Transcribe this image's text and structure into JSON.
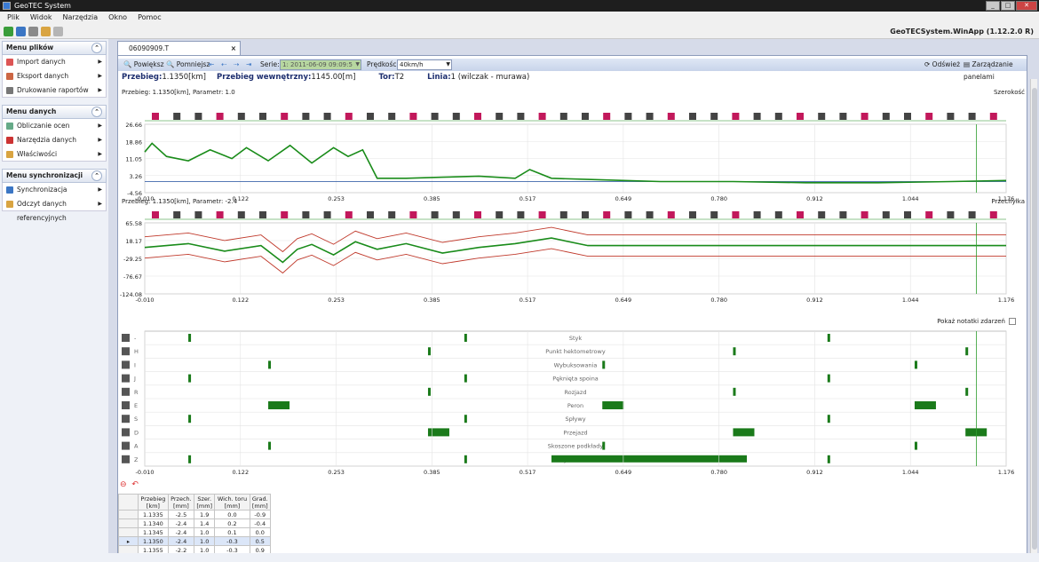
{
  "title": "GeoTEC System",
  "app_name": "GeoTECSystem.WinApp (1.12.2.0 R)",
  "menu": [
    "Plik",
    "Widok",
    "Narzędzia",
    "Okno",
    "Pomoc"
  ],
  "sidebar": {
    "sections": [
      {
        "title": "Menu plików",
        "items": [
          "Import danych",
          "Eksport danych",
          "Drukowanie raportów"
        ]
      },
      {
        "title": "Menu danych",
        "items": [
          "Obliczanie ocen",
          "Narzędzia danych",
          "Właściwości"
        ]
      },
      {
        "title": "Menu synchronizacji",
        "items": [
          "Synchronizacja",
          "Odczyt danych referencyjnych"
        ]
      }
    ]
  },
  "doc_tab": "06090909.T",
  "toolbar": {
    "zoom_in": "Powiększ",
    "zoom_out": "Pomniejsz",
    "series_label": "Serie:",
    "series_value": "1: 2011-06-09 09:09:5",
    "speed_label": "Prędkości:",
    "speed_value": "40km/h",
    "refresh": "Odśwież",
    "panels": "Zarządzanie panelami"
  },
  "info": {
    "przebieg_label": "Przebieg:",
    "przebieg_value": "1.1350[km]",
    "wewn_label": "Przebieg wewnętrzny:",
    "wewn_value": "1145.00[m]",
    "tor_label": "Tor:",
    "tor_value": "T2",
    "linia_label": "Linia:",
    "linia_value": "1 (wilczak - murawa)"
  },
  "chart1": {
    "header": "Przebieg: 1.1350[km],  Parametr: 1.0",
    "name": "Szerokość",
    "yticks": [
      "26.66",
      "18.86",
      "11.05",
      "3.26",
      "-4.56"
    ]
  },
  "chart2": {
    "header": "Przebieg: 1.1350[km],  Parametr: -2.4",
    "name": "Przechyłka",
    "yticks": [
      "65.58",
      "18.17",
      "-29.25",
      "-76.67",
      "-124.08"
    ]
  },
  "xticks": [
    "-0.010",
    "0.122",
    "0.253",
    "0.385",
    "0.517",
    "0.649",
    "0.780",
    "0.912",
    "1.044",
    "1.176"
  ],
  "events": {
    "note": "Pokaż notatki zdarzeń",
    "rows": [
      {
        "code": "-",
        "label": "Styk"
      },
      {
        "code": "H",
        "label": "Punkt hektometrowy"
      },
      {
        "code": "I",
        "label": "Wybuksowania"
      },
      {
        "code": "J",
        "label": "Pęknięta spoina"
      },
      {
        "code": "R",
        "label": "Rozjazd"
      },
      {
        "code": "E",
        "label": "Peron"
      },
      {
        "code": "S",
        "label": "Spływy"
      },
      {
        "code": "D",
        "label": "Przejazd"
      },
      {
        "code": "A",
        "label": "Skoszone podkłady"
      },
      {
        "code": "Z",
        "label": "Zużycie boczne"
      }
    ]
  },
  "chart_data": [
    {
      "type": "line",
      "title": "Szerokość",
      "ylim": [
        -4.56,
        26.66
      ],
      "xlim": [
        -0.01,
        1.176
      ],
      "x": [
        -0.01,
        0.0,
        0.02,
        0.05,
        0.08,
        0.11,
        0.13,
        0.16,
        0.19,
        0.22,
        0.25,
        0.27,
        0.29,
        0.31,
        0.35,
        0.4,
        0.45,
        0.5,
        0.52,
        0.55,
        0.6,
        0.65,
        0.7,
        0.8,
        0.9,
        1.0,
        1.1,
        1.176
      ],
      "series": [
        {
          "values": [
            14,
            18,
            12,
            10,
            15,
            11,
            16,
            10,
            17,
            9,
            16,
            12,
            15,
            2,
            2,
            2.5,
            3,
            2,
            6,
            2,
            1.5,
            1,
            0.5,
            0.5,
            0,
            0,
            0.5,
            1
          ]
        }
      ]
    },
    {
      "type": "line",
      "title": "Przechyłka",
      "ylim": [
        -124.08,
        65.58
      ],
      "xlim": [
        -0.01,
        1.176
      ],
      "x": [
        -0.01,
        0.05,
        0.1,
        0.15,
        0.18,
        0.2,
        0.22,
        0.25,
        0.28,
        0.31,
        0.35,
        0.4,
        0.45,
        0.5,
        0.55,
        0.6,
        0.65,
        0.7,
        0.8,
        0.9,
        1.0,
        1.1,
        1.176
      ],
      "series": [
        {
          "values": [
            0,
            10,
            -10,
            5,
            -40,
            -5,
            8,
            -20,
            15,
            -5,
            10,
            -15,
            0,
            10,
            25,
            5,
            5,
            5,
            5,
            5,
            5,
            5,
            5
          ]
        }
      ]
    }
  ]
}
